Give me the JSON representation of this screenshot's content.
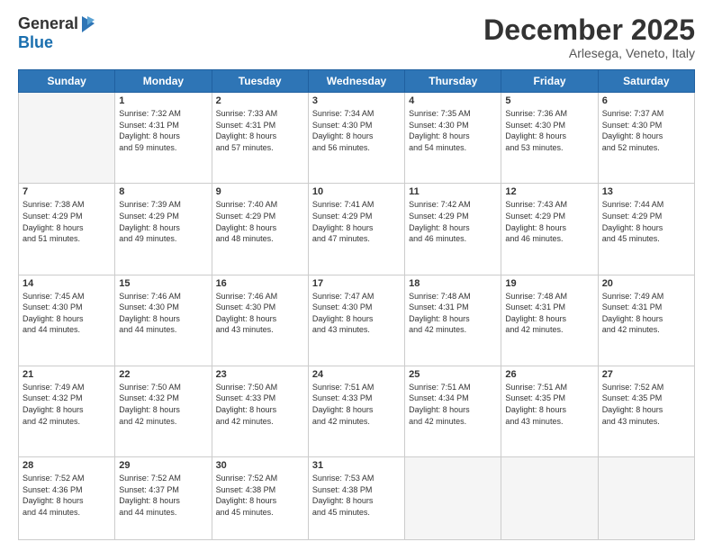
{
  "logo": {
    "general": "General",
    "blue": "Blue"
  },
  "header": {
    "month": "December 2025",
    "location": "Arlesega, Veneto, Italy"
  },
  "days_of_week": [
    "Sunday",
    "Monday",
    "Tuesday",
    "Wednesday",
    "Thursday",
    "Friday",
    "Saturday"
  ],
  "weeks": [
    [
      {
        "day": "",
        "sunrise": "",
        "sunset": "",
        "daylight": ""
      },
      {
        "day": "1",
        "sunrise": "Sunrise: 7:32 AM",
        "sunset": "Sunset: 4:31 PM",
        "daylight": "Daylight: 8 hours and 59 minutes."
      },
      {
        "day": "2",
        "sunrise": "Sunrise: 7:33 AM",
        "sunset": "Sunset: 4:31 PM",
        "daylight": "Daylight: 8 hours and 57 minutes."
      },
      {
        "day": "3",
        "sunrise": "Sunrise: 7:34 AM",
        "sunset": "Sunset: 4:30 PM",
        "daylight": "Daylight: 8 hours and 56 minutes."
      },
      {
        "day": "4",
        "sunrise": "Sunrise: 7:35 AM",
        "sunset": "Sunset: 4:30 PM",
        "daylight": "Daylight: 8 hours and 54 minutes."
      },
      {
        "day": "5",
        "sunrise": "Sunrise: 7:36 AM",
        "sunset": "Sunset: 4:30 PM",
        "daylight": "Daylight: 8 hours and 53 minutes."
      },
      {
        "day": "6",
        "sunrise": "Sunrise: 7:37 AM",
        "sunset": "Sunset: 4:30 PM",
        "daylight": "Daylight: 8 hours and 52 minutes."
      }
    ],
    [
      {
        "day": "7",
        "sunrise": "Sunrise: 7:38 AM",
        "sunset": "Sunset: 4:29 PM",
        "daylight": "Daylight: 8 hours and 51 minutes."
      },
      {
        "day": "8",
        "sunrise": "Sunrise: 7:39 AM",
        "sunset": "Sunset: 4:29 PM",
        "daylight": "Daylight: 8 hours and 49 minutes."
      },
      {
        "day": "9",
        "sunrise": "Sunrise: 7:40 AM",
        "sunset": "Sunset: 4:29 PM",
        "daylight": "Daylight: 8 hours and 48 minutes."
      },
      {
        "day": "10",
        "sunrise": "Sunrise: 7:41 AM",
        "sunset": "Sunset: 4:29 PM",
        "daylight": "Daylight: 8 hours and 47 minutes."
      },
      {
        "day": "11",
        "sunrise": "Sunrise: 7:42 AM",
        "sunset": "Sunset: 4:29 PM",
        "daylight": "Daylight: 8 hours and 46 minutes."
      },
      {
        "day": "12",
        "sunrise": "Sunrise: 7:43 AM",
        "sunset": "Sunset: 4:29 PM",
        "daylight": "Daylight: 8 hours and 46 minutes."
      },
      {
        "day": "13",
        "sunrise": "Sunrise: 7:44 AM",
        "sunset": "Sunset: 4:29 PM",
        "daylight": "Daylight: 8 hours and 45 minutes."
      }
    ],
    [
      {
        "day": "14",
        "sunrise": "Sunrise: 7:45 AM",
        "sunset": "Sunset: 4:30 PM",
        "daylight": "Daylight: 8 hours and 44 minutes."
      },
      {
        "day": "15",
        "sunrise": "Sunrise: 7:46 AM",
        "sunset": "Sunset: 4:30 PM",
        "daylight": "Daylight: 8 hours and 44 minutes."
      },
      {
        "day": "16",
        "sunrise": "Sunrise: 7:46 AM",
        "sunset": "Sunset: 4:30 PM",
        "daylight": "Daylight: 8 hours and 43 minutes."
      },
      {
        "day": "17",
        "sunrise": "Sunrise: 7:47 AM",
        "sunset": "Sunset: 4:30 PM",
        "daylight": "Daylight: 8 hours and 43 minutes."
      },
      {
        "day": "18",
        "sunrise": "Sunrise: 7:48 AM",
        "sunset": "Sunset: 4:31 PM",
        "daylight": "Daylight: 8 hours and 42 minutes."
      },
      {
        "day": "19",
        "sunrise": "Sunrise: 7:48 AM",
        "sunset": "Sunset: 4:31 PM",
        "daylight": "Daylight: 8 hours and 42 minutes."
      },
      {
        "day": "20",
        "sunrise": "Sunrise: 7:49 AM",
        "sunset": "Sunset: 4:31 PM",
        "daylight": "Daylight: 8 hours and 42 minutes."
      }
    ],
    [
      {
        "day": "21",
        "sunrise": "Sunrise: 7:49 AM",
        "sunset": "Sunset: 4:32 PM",
        "daylight": "Daylight: 8 hours and 42 minutes."
      },
      {
        "day": "22",
        "sunrise": "Sunrise: 7:50 AM",
        "sunset": "Sunset: 4:32 PM",
        "daylight": "Daylight: 8 hours and 42 minutes."
      },
      {
        "day": "23",
        "sunrise": "Sunrise: 7:50 AM",
        "sunset": "Sunset: 4:33 PM",
        "daylight": "Daylight: 8 hours and 42 minutes."
      },
      {
        "day": "24",
        "sunrise": "Sunrise: 7:51 AM",
        "sunset": "Sunset: 4:33 PM",
        "daylight": "Daylight: 8 hours and 42 minutes."
      },
      {
        "day": "25",
        "sunrise": "Sunrise: 7:51 AM",
        "sunset": "Sunset: 4:34 PM",
        "daylight": "Daylight: 8 hours and 42 minutes."
      },
      {
        "day": "26",
        "sunrise": "Sunrise: 7:51 AM",
        "sunset": "Sunset: 4:35 PM",
        "daylight": "Daylight: 8 hours and 43 minutes."
      },
      {
        "day": "27",
        "sunrise": "Sunrise: 7:52 AM",
        "sunset": "Sunset: 4:35 PM",
        "daylight": "Daylight: 8 hours and 43 minutes."
      }
    ],
    [
      {
        "day": "28",
        "sunrise": "Sunrise: 7:52 AM",
        "sunset": "Sunset: 4:36 PM",
        "daylight": "Daylight: 8 hours and 44 minutes."
      },
      {
        "day": "29",
        "sunrise": "Sunrise: 7:52 AM",
        "sunset": "Sunset: 4:37 PM",
        "daylight": "Daylight: 8 hours and 44 minutes."
      },
      {
        "day": "30",
        "sunrise": "Sunrise: 7:52 AM",
        "sunset": "Sunset: 4:38 PM",
        "daylight": "Daylight: 8 hours and 45 minutes."
      },
      {
        "day": "31",
        "sunrise": "Sunrise: 7:53 AM",
        "sunset": "Sunset: 4:38 PM",
        "daylight": "Daylight: 8 hours and 45 minutes."
      },
      {
        "day": "",
        "sunrise": "",
        "sunset": "",
        "daylight": ""
      },
      {
        "day": "",
        "sunrise": "",
        "sunset": "",
        "daylight": ""
      },
      {
        "day": "",
        "sunrise": "",
        "sunset": "",
        "daylight": ""
      }
    ]
  ]
}
